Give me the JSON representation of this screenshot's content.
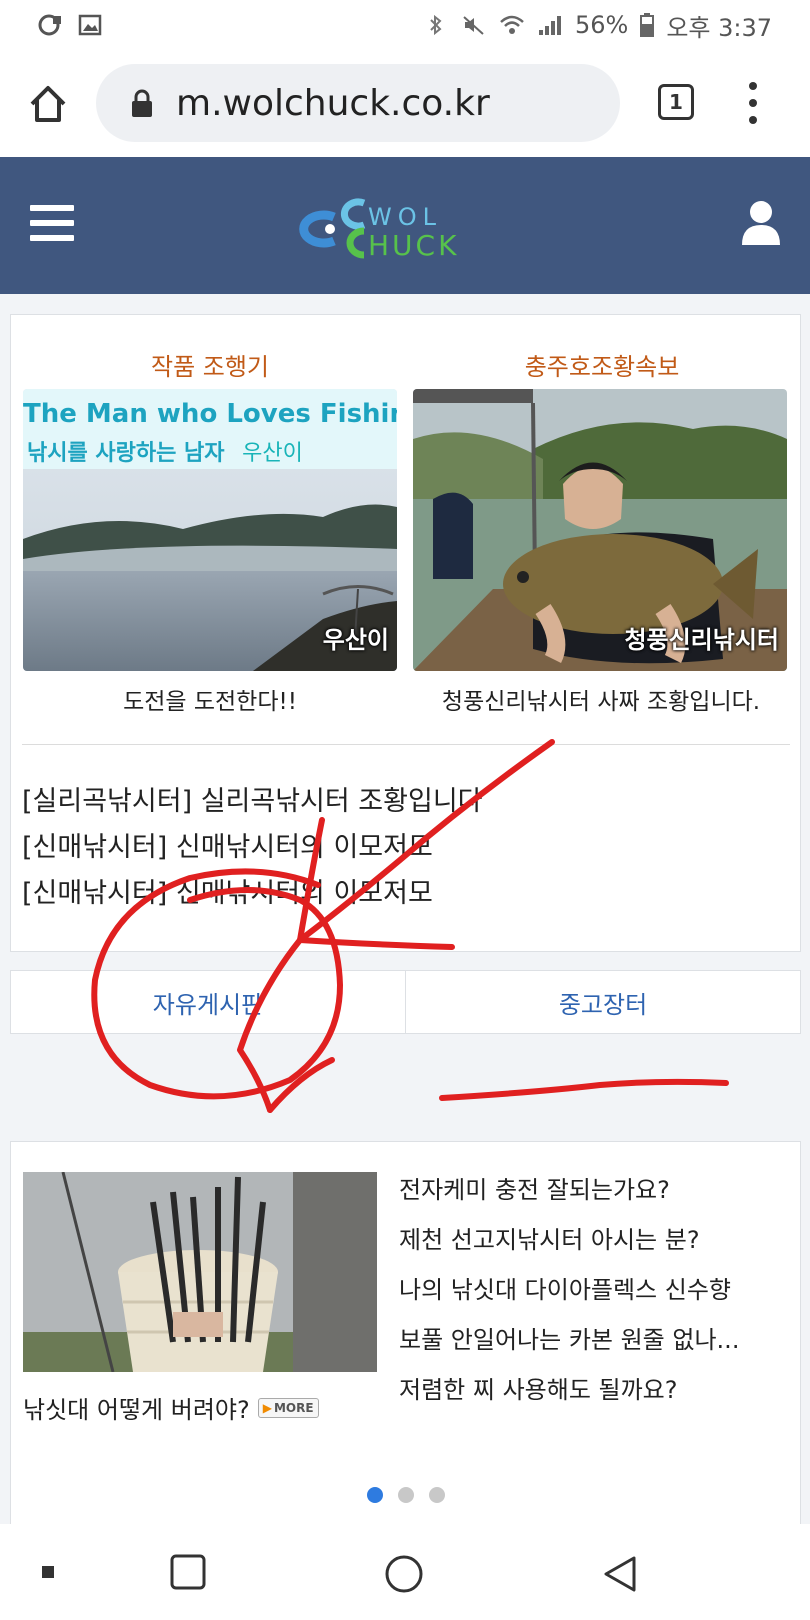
{
  "status_bar": {
    "battery": "56%",
    "time": "오후 3:37"
  },
  "browser": {
    "url": "m.wolchuck.co.kr",
    "tab_count": "1"
  },
  "site": {
    "logo_alt": "WOL CHUCK"
  },
  "featured": [
    {
      "section_title": "작품 조행기",
      "image_banner_en": "The Man who Loves Fishing",
      "image_banner_ko": "낚시를 사랑하는 남자",
      "image_banner_author": "우산이",
      "image_tag": "우산이",
      "caption": "도전을 도전한다!!"
    },
    {
      "section_title": "충주호조황속보",
      "image_tag": "청풍신리낚시터",
      "caption": "청풍신리낚시터 사짜 조황입니다."
    }
  ],
  "news": [
    "[실리곡낚시터] 실리곡낚시터 조황입니다",
    "[신매낚시터] 신매낚시터의 이모저모",
    "[신매낚시터] 신매낚시터의 이모저모"
  ],
  "board_tabs": [
    "자유게시판",
    "중고장터"
  ],
  "free_board": {
    "featured_caption": "낚싯대 어떻게 버려야?",
    "more_label": "MORE",
    "posts": [
      "전자케미 충전 잘되는가요?",
      "제천 선고지낚시터 아시는 분?",
      "나의 낚싯대 다이아플렉스 신수향",
      "보풀 안일어나는 카본 원줄 없나...",
      "저렴한 찌 사용해도 될까요?"
    ],
    "carousel_active_index": 0,
    "carousel_count": 3
  },
  "colors": {
    "header_bg": "#40577f",
    "section_title": "#c15a17",
    "tab_link": "#2e63b0",
    "annotation": "#e02020"
  }
}
